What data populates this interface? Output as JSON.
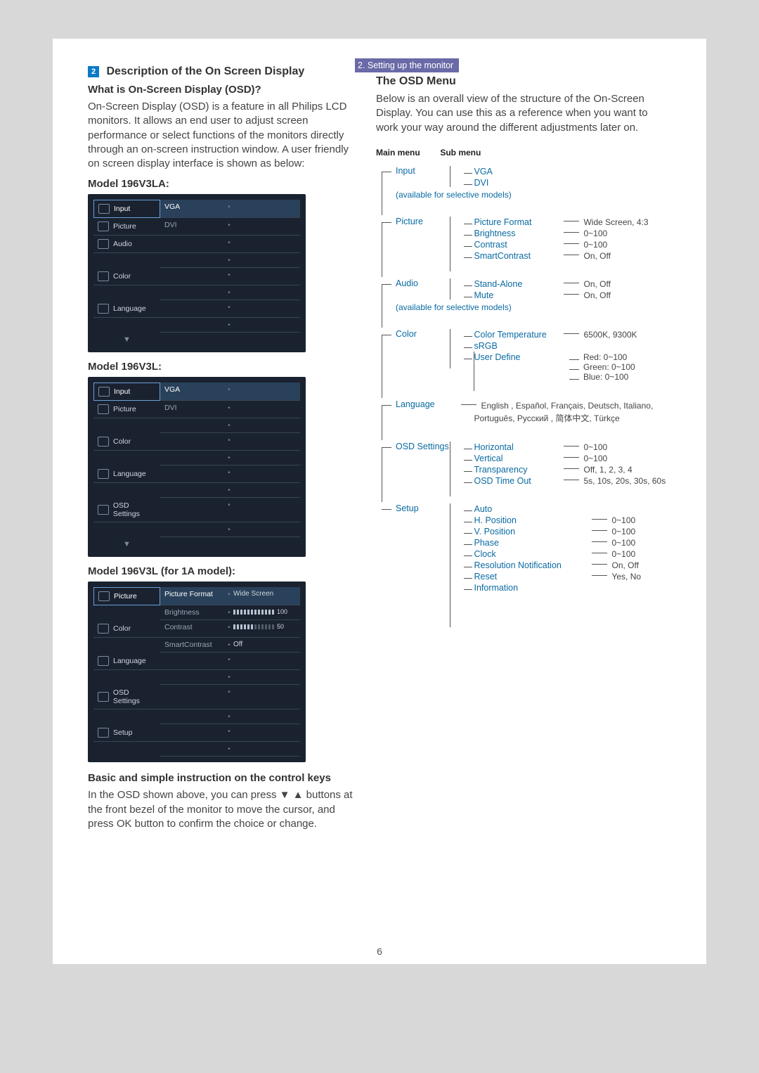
{
  "section_tag": "2. Setting up the monitor",
  "section2": {
    "num": "2",
    "title": "Description of the On Screen Display"
  },
  "left": {
    "q1": "What is On-Screen Display (OSD)?",
    "p1": "On-Screen Display (OSD) is a feature in all Philips LCD monitors. It allows an end user to adjust screen performance or select functions of the monitors directly through an on-screen instruction window. A user friendly on screen display interface is shown as below:",
    "model_a_title": "Model 196V3LA:",
    "model_b_title": "Model 196V3L:",
    "model_c_title": "Model 196V3L (for 1A model):",
    "osd_a": {
      "menus": [
        "Input",
        "Picture",
        "Audio",
        "Color",
        "Language"
      ],
      "arrow": "▼",
      "sub_sel": [
        "VGA",
        "DVI"
      ]
    },
    "osd_b": {
      "menus": [
        "Input",
        "Picture",
        "Color",
        "Language",
        "OSD Settings"
      ],
      "arrow": "▼",
      "sub_sel": [
        "VGA",
        "DVI"
      ]
    },
    "osd_c": {
      "menus": [
        "Picture",
        "Color",
        "Language",
        "OSD Settings",
        "Setup"
      ],
      "arrow": "",
      "sub": {
        "items": [
          "Picture Format",
          "Brightness",
          "Contrast",
          "SmartContrast"
        ],
        "vals": [
          "Wide Screen",
          "100",
          "50",
          "Off"
        ]
      }
    },
    "basic_title": "Basic and simple instruction on the control keys",
    "basic_p": "In the OSD shown above, you can press ▼ ▲ buttons at the front bezel of the monitor to move the cursor, and press OK button to confirm the choice or change."
  },
  "right": {
    "title": "The OSD Menu",
    "p": "Below is an overall view of the structure of the On-Screen Display. You can use this as a reference when you want to work your way around the different adjustments later on.",
    "headers": {
      "main": "Main menu",
      "sub": "Sub menu"
    },
    "tree": {
      "input": {
        "label": "Input",
        "items": [
          "VGA",
          "DVI"
        ],
        "note": "(available for selective models)"
      },
      "picture": {
        "label": "Picture",
        "items": [
          {
            "l": "Picture Format",
            "v": "Wide Screen, 4:3"
          },
          {
            "l": "Brightness",
            "v": "0~100"
          },
          {
            "l": "Contrast",
            "v": "0~100"
          },
          {
            "l": "SmartContrast",
            "v": "On, Off"
          }
        ]
      },
      "audio": {
        "label": "Audio",
        "items": [
          {
            "l": "Stand-Alone",
            "v": "On, Off"
          },
          {
            "l": "Mute",
            "v": "On, Off"
          }
        ],
        "note": "(available for selective models)"
      },
      "color": {
        "label": "Color",
        "items": [
          {
            "l": "Color Temperature",
            "v": "6500K, 9300K"
          },
          {
            "l": "sRGB",
            "v": ""
          },
          {
            "l": "User Define",
            "ter": [
              "Red: 0~100",
              "Green: 0~100",
              "Blue: 0~100"
            ]
          }
        ]
      },
      "language": {
        "label": "Language",
        "langs": "English , Español, Français, Deutsch, Italiano, Português, Русский , 简体中文, Türkçe"
      },
      "osd": {
        "label": "OSD Settings",
        "items": [
          {
            "l": "Horizontal",
            "v": "0~100"
          },
          {
            "l": "Vertical",
            "v": "0~100"
          },
          {
            "l": "Transparency",
            "v": "Off, 1, 2, 3, 4"
          },
          {
            "l": "OSD Time Out",
            "v": "5s, 10s, 20s, 30s, 60s"
          }
        ]
      },
      "setup": {
        "label": "Setup",
        "items": [
          {
            "l": "Auto",
            "v": ""
          },
          {
            "l": "H. Position",
            "v": "0~100"
          },
          {
            "l": "V. Position",
            "v": "0~100"
          },
          {
            "l": "Phase",
            "v": "0~100"
          },
          {
            "l": "Clock",
            "v": "0~100"
          },
          {
            "l": "Resolution Notification",
            "v": "On, Off"
          },
          {
            "l": "Reset",
            "v": "Yes, No"
          },
          {
            "l": "Information",
            "v": ""
          }
        ]
      }
    }
  },
  "pagenum": "6"
}
